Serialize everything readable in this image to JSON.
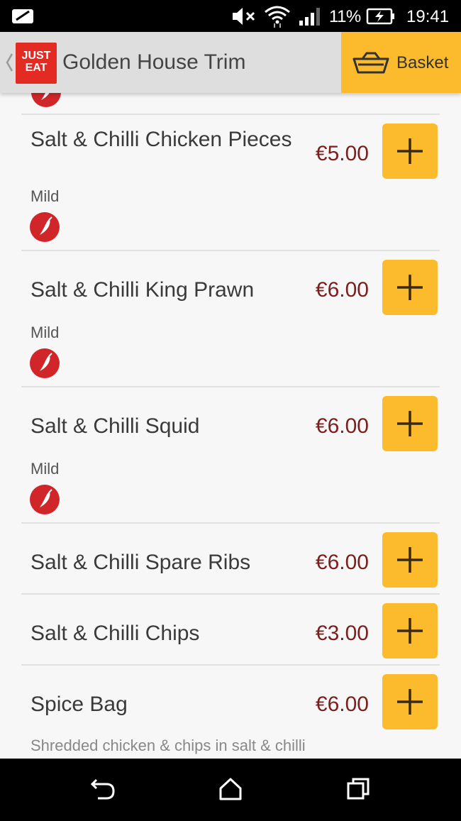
{
  "status_bar": {
    "battery_percent": "11%",
    "time": "19:41"
  },
  "header": {
    "logo_line1": "JUST",
    "logo_line2": "EAT",
    "restaurant_name": "Golden House Trim",
    "basket_label": "Basket",
    "accent_color": "#fbbb2c",
    "brand_color": "#e32b24"
  },
  "menu": {
    "items": [
      {
        "name": "Salt & Chilli Chicken Pieces",
        "price": "€5.00",
        "spice": "Mild"
      },
      {
        "name": "Salt & Chilli King Prawn",
        "price": "€6.00",
        "spice": "Mild"
      },
      {
        "name": "Salt & Chilli Squid",
        "price": "€6.00",
        "spice": "Mild"
      },
      {
        "name": "Salt & Chilli Spare Ribs",
        "price": "€6.00"
      },
      {
        "name": "Salt & Chilli Chips",
        "price": "€3.00"
      },
      {
        "name": "Spice Bag",
        "price": "€6.00",
        "description": "Shredded chicken & chips in salt & chilli"
      }
    ],
    "price_color": "#7a1e1e"
  }
}
